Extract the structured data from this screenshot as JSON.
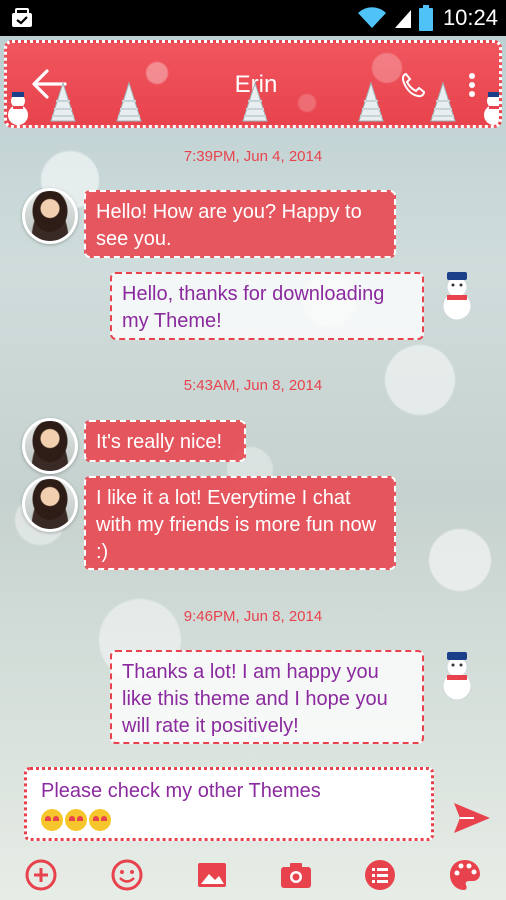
{
  "status_bar": {
    "time": "10:24"
  },
  "header": {
    "title": "Erin"
  },
  "messages": [
    {
      "timestamp": "7:39PM, Jun 4, 2014"
    },
    {
      "incoming_1": "Hello! How are you? Happy to see you."
    },
    {
      "outgoing_1": "Hello, thanks for downloading my Theme!"
    },
    {
      "timestamp": "5:43AM, Jun 8, 2014"
    },
    {
      "incoming_2": "It's really nice!"
    },
    {
      "incoming_3": "I like it a lot! Everytime I chat with my friends is more fun now :)"
    },
    {
      "timestamp": "9:46PM, Jun 8, 2014"
    },
    {
      "outgoing_2": "Thanks a lot! I am happy you like this theme and I hope you will rate it positively!"
    }
  ],
  "composer": {
    "text": "Please check my other Themes"
  },
  "toolbar": {
    "icons": [
      "add-icon",
      "emoji-icon",
      "image-icon",
      "camera-icon",
      "list-icon",
      "palette-icon"
    ]
  },
  "colors": {
    "accent": "#e8434d",
    "outgoing_text": "#8a2a9e"
  },
  "icons": {
    "status": [
      "notification-icon",
      "wifi-icon",
      "signal-icon",
      "battery-icon"
    ],
    "header": [
      "back-arrow-icon",
      "phone-icon",
      "more-vert-icon"
    ],
    "send": "send-icon"
  }
}
